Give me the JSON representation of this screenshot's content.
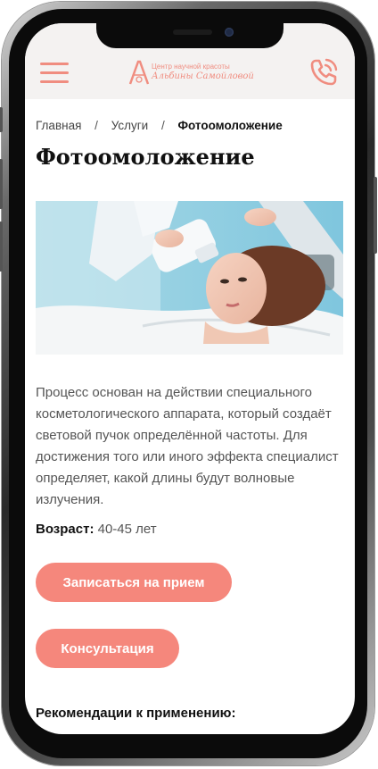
{
  "header": {
    "menu_icon": "hamburger-menu-icon",
    "logo": {
      "mark_letter": "A",
      "line1": "Центр научной красоты",
      "line2": "Альбины Самойловой"
    },
    "call_icon": "phone-call-icon",
    "accent_color": "#f08d80"
  },
  "breadcrumb": {
    "items": [
      "Главная",
      "Услуги"
    ],
    "separator": "/",
    "current": "Фотоомоложение"
  },
  "page": {
    "title": "Фотоомоложение",
    "image_alt": "woman-receiving-photorejuvenation-treatment",
    "description": "Процесс основан на действии специального косметологического аппарата, который создаёт световой пучок определённой частоты. Для достижения того или иного эффекта специалист определяет, какой длины будут волновые излучения.",
    "age_label": "Возраст:",
    "age_value": "40-45 лет",
    "recommendations_heading": "Рекомендации к применению:"
  },
  "buttons": {
    "book": "Записаться на прием",
    "consult": "Консультация",
    "color": "#f5877c"
  }
}
